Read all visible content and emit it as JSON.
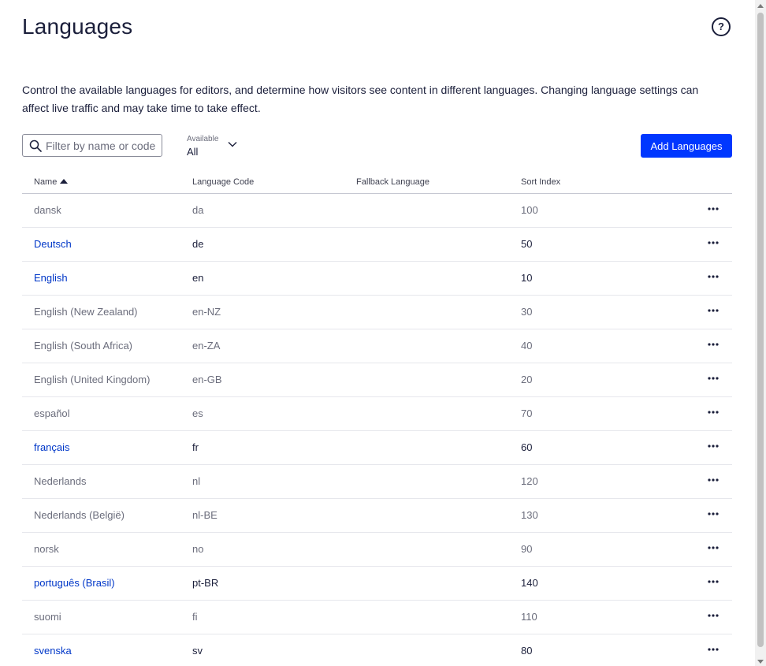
{
  "page": {
    "title": "Languages",
    "help_label": "?",
    "description": "Control the available languages for editors, and determine how visitors see content in different languages. Changing language settings can affect live traffic and may take time to take effect."
  },
  "toolbar": {
    "filter_placeholder": "Filter by name or code",
    "filter_value": "",
    "availability_label": "Available",
    "availability_value": "All",
    "add_button_label": "Add Languages",
    "accent_color": "#0037ff"
  },
  "table": {
    "columns": {
      "name": "Name",
      "code": "Language Code",
      "fallback": "Fallback Language",
      "sort": "Sort Index"
    },
    "sorted_by": "Name",
    "sort_direction": "ascending",
    "rows": [
      {
        "name": "dansk",
        "code": "da",
        "fallback": "",
        "sort": "100",
        "enabled": false
      },
      {
        "name": "Deutsch",
        "code": "de",
        "fallback": "",
        "sort": "50",
        "enabled": true
      },
      {
        "name": "English",
        "code": "en",
        "fallback": "",
        "sort": "10",
        "enabled": true
      },
      {
        "name": "English (New Zealand)",
        "code": "en-NZ",
        "fallback": "",
        "sort": "30",
        "enabled": false
      },
      {
        "name": "English (South Africa)",
        "code": "en-ZA",
        "fallback": "",
        "sort": "40",
        "enabled": false
      },
      {
        "name": "English (United Kingdom)",
        "code": "en-GB",
        "fallback": "",
        "sort": "20",
        "enabled": false
      },
      {
        "name": "español",
        "code": "es",
        "fallback": "",
        "sort": "70",
        "enabled": false
      },
      {
        "name": "français",
        "code": "fr",
        "fallback": "",
        "sort": "60",
        "enabled": true
      },
      {
        "name": "Nederlands",
        "code": "nl",
        "fallback": "",
        "sort": "120",
        "enabled": false
      },
      {
        "name": "Nederlands (België)",
        "code": "nl-BE",
        "fallback": "",
        "sort": "130",
        "enabled": false
      },
      {
        "name": "norsk",
        "code": "no",
        "fallback": "",
        "sort": "90",
        "enabled": false
      },
      {
        "name": "português (Brasil)",
        "code": "pt-BR",
        "fallback": "",
        "sort": "140",
        "enabled": true
      },
      {
        "name": "suomi",
        "code": "fi",
        "fallback": "",
        "sort": "110",
        "enabled": false
      },
      {
        "name": "svenska",
        "code": "sv",
        "fallback": "",
        "sort": "80",
        "enabled": true
      }
    ],
    "row_menu_icon": "more-horizontal-icon"
  },
  "colors": {
    "enabled_name": "#0037c8",
    "disabled_text": "#6b6d7c",
    "primary_text": "#1b1f3b"
  }
}
